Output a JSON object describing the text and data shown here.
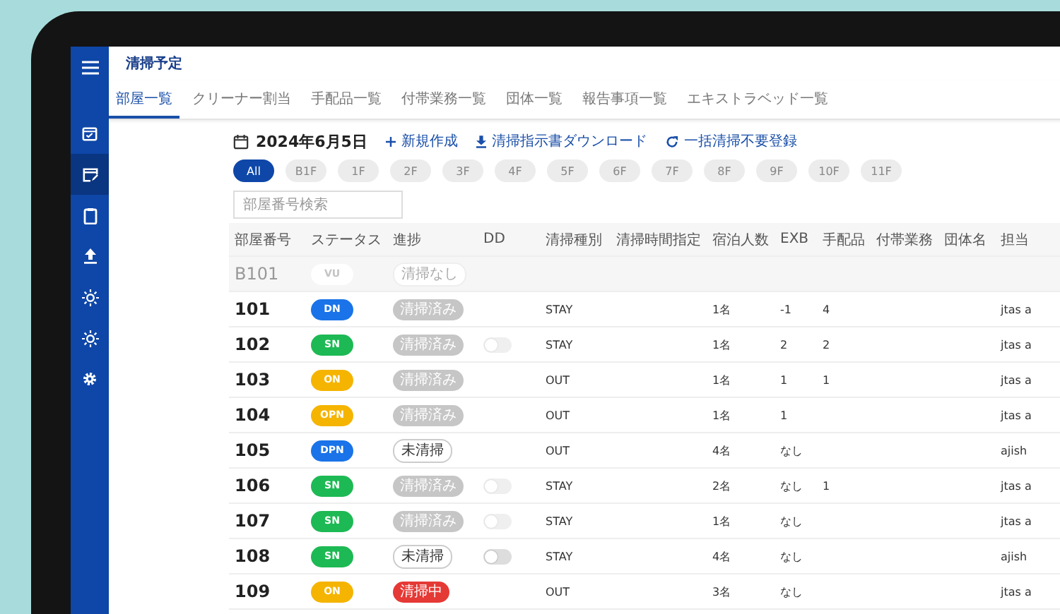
{
  "app": {
    "title": "清掃予定"
  },
  "sidebar": {
    "items": [
      {
        "selected": false
      },
      {
        "selected": true
      },
      {
        "selected": false
      },
      {
        "selected": false
      },
      {
        "selected": false
      },
      {
        "selected": false
      },
      {
        "selected": false
      }
    ]
  },
  "tabs": [
    {
      "label": "部屋一覧",
      "selected": true
    },
    {
      "label": "クリーナー割当",
      "selected": false
    },
    {
      "label": "手配品一覧",
      "selected": false
    },
    {
      "label": "付帯業務一覧",
      "selected": false
    },
    {
      "label": "団体一覧",
      "selected": false
    },
    {
      "label": "報告事項一覧",
      "selected": false
    },
    {
      "label": "エキストラベッド一覧",
      "selected": false
    }
  ],
  "date": "2024年6月5日",
  "actions": [
    "新規作成",
    "清掃指示書ダウンロード",
    "一括清掃不要登録"
  ],
  "floors": [
    {
      "label": "All",
      "selected": true
    },
    {
      "label": "B1F",
      "selected": false
    },
    {
      "label": "1F",
      "selected": false
    },
    {
      "label": "2F",
      "selected": false
    },
    {
      "label": "3F",
      "selected": false
    },
    {
      "label": "4F",
      "selected": false
    },
    {
      "label": "5F",
      "selected": false
    },
    {
      "label": "6F",
      "selected": false
    },
    {
      "label": "7F",
      "selected": false
    },
    {
      "label": "8F",
      "selected": false
    },
    {
      "label": "9F",
      "selected": false
    },
    {
      "label": "10F",
      "selected": false
    },
    {
      "label": "11F",
      "selected": false
    }
  ],
  "search": {
    "placeholder": "部屋番号検索"
  },
  "table": {
    "columns": [
      "部屋番号",
      "ステータス",
      "進捗",
      "DD",
      "清掃種別",
      "清掃時間指定",
      "宿泊人数",
      "EXB",
      "手配品",
      "付帯業務",
      "団体名",
      "担当"
    ],
    "rows": [
      {
        "room": "B101",
        "disabled": true,
        "status": {
          "label": "VU",
          "color": "#ffffff"
        },
        "progress": {
          "label": "清掃なし",
          "kind": "none"
        }
      },
      {
        "room": "101",
        "disabled": false,
        "status": {
          "label": "DN",
          "color": "#1a73e8"
        },
        "progress": {
          "label": "清掃済み",
          "kind": "done"
        },
        "cleaning_type": "STAY",
        "guests": "1名",
        "exb": "-1",
        "items": "4",
        "assignee": "jtas a"
      },
      {
        "room": "102",
        "disabled": false,
        "status": {
          "label": "SN",
          "color": "#1db954"
        },
        "progress": {
          "label": "清掃済み",
          "kind": "done"
        },
        "dd": {
          "on": false,
          "disabled": true
        },
        "cleaning_type": "STAY",
        "guests": "1名",
        "exb": "2",
        "items": "2",
        "assignee": "jtas a"
      },
      {
        "room": "103",
        "disabled": false,
        "status": {
          "label": "ON",
          "color": "#f5b400"
        },
        "progress": {
          "label": "清掃済み",
          "kind": "done"
        },
        "cleaning_type": "OUT",
        "guests": "1名",
        "exb": "1",
        "items": "1",
        "assignee": "jtas a"
      },
      {
        "room": "104",
        "disabled": false,
        "status": {
          "label": "OPN",
          "color": "#f5b400"
        },
        "progress": {
          "label": "清掃済み",
          "kind": "done"
        },
        "cleaning_type": "OUT",
        "guests": "1名",
        "exb": "1",
        "assignee": "jtas a"
      },
      {
        "room": "105",
        "disabled": false,
        "status": {
          "label": "DPN",
          "color": "#1a73e8"
        },
        "progress": {
          "label": "未清掃",
          "kind": "todo"
        },
        "cleaning_type": "OUT",
        "guests": "4名",
        "exb": "なし",
        "assignee": "ajish"
      },
      {
        "room": "106",
        "disabled": false,
        "status": {
          "label": "SN",
          "color": "#1db954"
        },
        "progress": {
          "label": "清掃済み",
          "kind": "done"
        },
        "dd": {
          "on": false,
          "disabled": true
        },
        "cleaning_type": "STAY",
        "guests": "2名",
        "exb": "なし",
        "items": "1",
        "assignee": "jtas a"
      },
      {
        "room": "107",
        "disabled": false,
        "status": {
          "label": "SN",
          "color": "#1db954"
        },
        "progress": {
          "label": "清掃済み",
          "kind": "done"
        },
        "dd": {
          "on": false,
          "disabled": true
        },
        "cleaning_type": "STAY",
        "guests": "1名",
        "exb": "なし",
        "assignee": "jtas a"
      },
      {
        "room": "108",
        "disabled": false,
        "status": {
          "label": "SN",
          "color": "#1db954"
        },
        "progress": {
          "label": "未清掃",
          "kind": "todo"
        },
        "dd": {
          "on": false,
          "disabled": false
        },
        "cleaning_type": "STAY",
        "guests": "4名",
        "exb": "なし",
        "assignee": "ajish"
      },
      {
        "room": "109",
        "disabled": false,
        "status": {
          "label": "ON",
          "color": "#f5b400"
        },
        "progress": {
          "label": "清掃中",
          "kind": "active"
        },
        "cleaning_type": "OUT",
        "guests": "3名",
        "exb": "なし",
        "assignee": "jtas a"
      }
    ]
  }
}
